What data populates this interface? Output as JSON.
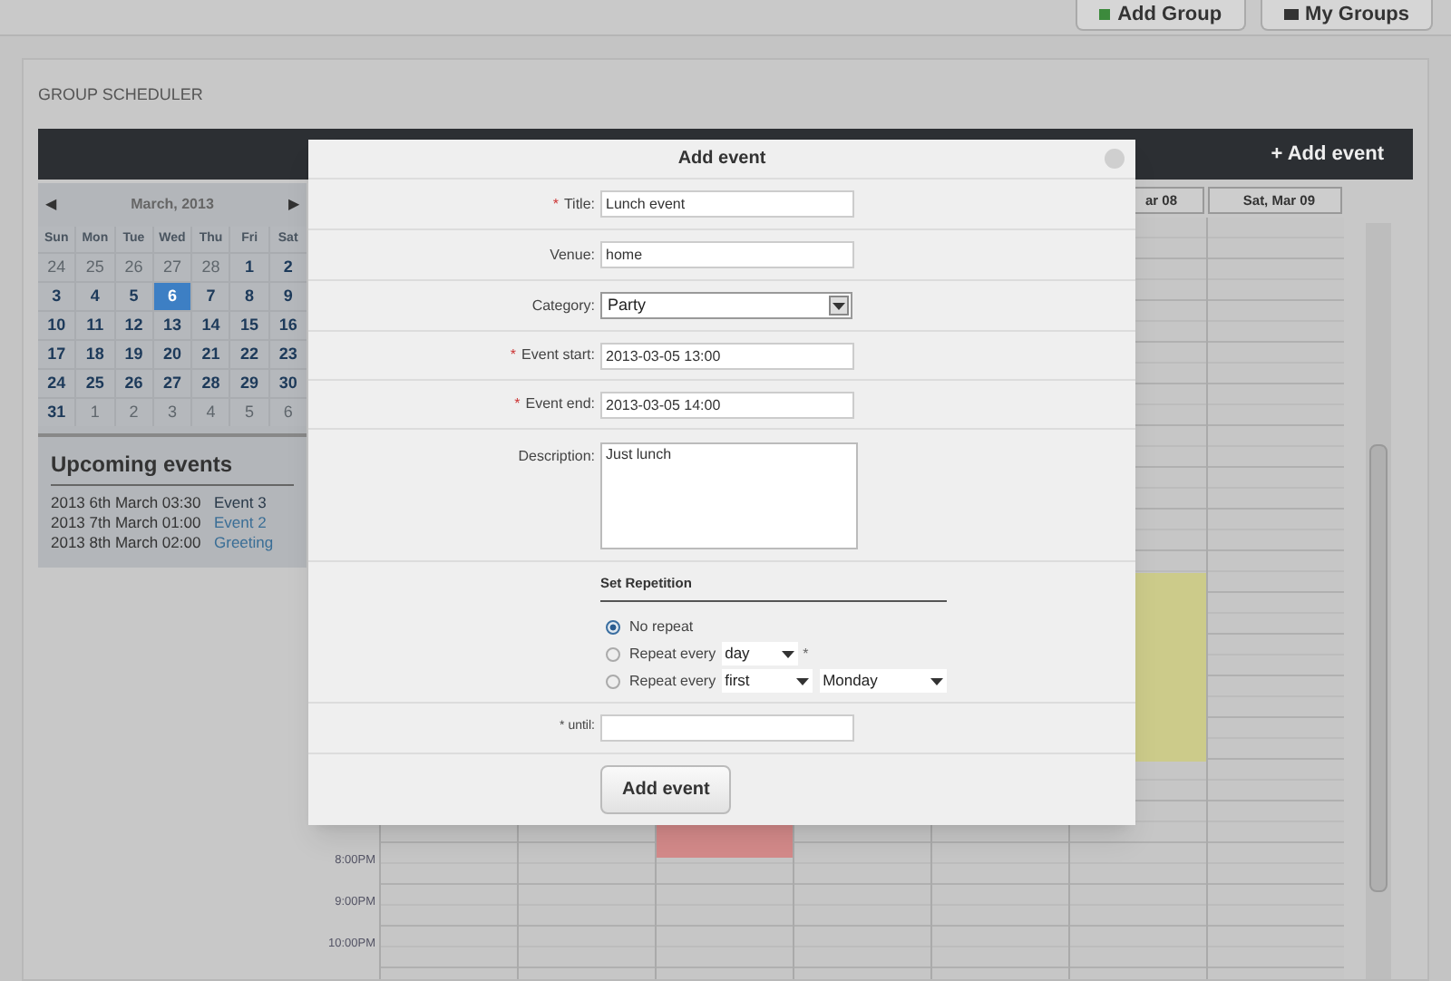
{
  "top_bar": {
    "buttons": [
      {
        "label": "Add Group"
      },
      {
        "label": "My Groups"
      }
    ]
  },
  "panel": {
    "title": "GROUP SCHEDULER"
  },
  "toolbar": {
    "add_button": "+ Add event"
  },
  "mini_calendar": {
    "month": "March, 2013",
    "prev": "◀",
    "next": "▶",
    "weekdays": [
      "Sun",
      "Mon",
      "Tue",
      "Wed",
      "Thu",
      "Fri",
      "Sat"
    ],
    "weeks": [
      [
        {
          "day": "24",
          "other_month": true,
          "selected": false
        },
        {
          "day": "25",
          "other_month": true,
          "selected": false
        },
        {
          "day": "26",
          "other_month": true,
          "selected": false
        },
        {
          "day": "27",
          "other_month": true,
          "selected": false
        },
        {
          "day": "28",
          "other_month": true,
          "selected": false
        },
        {
          "day": "1",
          "other_month": false,
          "selected": false
        },
        {
          "day": "2",
          "other_month": false,
          "selected": false
        }
      ],
      [
        {
          "day": "3",
          "other_month": false,
          "selected": false
        },
        {
          "day": "4",
          "other_month": false,
          "selected": false
        },
        {
          "day": "5",
          "other_month": false,
          "selected": false
        },
        {
          "day": "6",
          "other_month": false,
          "selected": true
        },
        {
          "day": "7",
          "other_month": false,
          "selected": false
        },
        {
          "day": "8",
          "other_month": false,
          "selected": false
        },
        {
          "day": "9",
          "other_month": false,
          "selected": false
        }
      ],
      [
        {
          "day": "10",
          "other_month": false,
          "selected": false
        },
        {
          "day": "11",
          "other_month": false,
          "selected": false
        },
        {
          "day": "12",
          "other_month": false,
          "selected": false
        },
        {
          "day": "13",
          "other_month": false,
          "selected": false
        },
        {
          "day": "14",
          "other_month": false,
          "selected": false
        },
        {
          "day": "15",
          "other_month": false,
          "selected": false
        },
        {
          "day": "16",
          "other_month": false,
          "selected": false
        }
      ],
      [
        {
          "day": "17",
          "other_month": false,
          "selected": false
        },
        {
          "day": "18",
          "other_month": false,
          "selected": false
        },
        {
          "day": "19",
          "other_month": false,
          "selected": false
        },
        {
          "day": "20",
          "other_month": false,
          "selected": false
        },
        {
          "day": "21",
          "other_month": false,
          "selected": false
        },
        {
          "day": "22",
          "other_month": false,
          "selected": false
        },
        {
          "day": "23",
          "other_month": false,
          "selected": false
        }
      ],
      [
        {
          "day": "24",
          "other_month": false,
          "selected": false
        },
        {
          "day": "25",
          "other_month": false,
          "selected": false
        },
        {
          "day": "26",
          "other_month": false,
          "selected": false
        },
        {
          "day": "27",
          "other_month": false,
          "selected": false
        },
        {
          "day": "28",
          "other_month": false,
          "selected": false
        },
        {
          "day": "29",
          "other_month": false,
          "selected": false
        },
        {
          "day": "30",
          "other_month": false,
          "selected": false
        }
      ],
      [
        {
          "day": "31",
          "other_month": false,
          "selected": false
        },
        {
          "day": "1",
          "other_month": true,
          "selected": false
        },
        {
          "day": "2",
          "other_month": true,
          "selected": false
        },
        {
          "day": "3",
          "other_month": true,
          "selected": false
        },
        {
          "day": "4",
          "other_month": true,
          "selected": false
        },
        {
          "day": "5",
          "other_month": true,
          "selected": false
        },
        {
          "day": "6",
          "other_month": true,
          "selected": false
        }
      ]
    ]
  },
  "upcoming": {
    "title": "Upcoming events",
    "items": [
      {
        "date": "2013 6th March 03:30",
        "name": "Event 3",
        "color": "#2a3a4a"
      },
      {
        "date": "2013 7th March 01:00",
        "name": "Event 2",
        "color": "#3a6e96"
      },
      {
        "date": "2013 8th March 02:00",
        "name": "Greeting",
        "color": "#3a6e96"
      }
    ]
  },
  "week_grid": {
    "times": [
      "8:00PM",
      "9:00PM",
      "10:00PM"
    ],
    "columns": [
      {},
      {},
      {
        "events": [
          {
            "color": "#d48a8a"
          }
        ]
      },
      {},
      {},
      {
        "header": "ar 08",
        "events": [
          {
            "color": "#cccb8a"
          }
        ]
      },
      {
        "header": "Sat, Mar 09"
      }
    ]
  },
  "dialog": {
    "title": "Add event",
    "fields": [
      {
        "kind": "text",
        "required_mark": "*",
        "label": "Title:",
        "value": "Lunch event"
      },
      {
        "kind": "text",
        "label": "Venue:",
        "value": "home"
      },
      {
        "kind": "select",
        "label": "Category:",
        "value": "Party"
      },
      {
        "kind": "text",
        "required_mark": "*",
        "label": "Event start:",
        "value": "2013-03-05 13:00"
      },
      {
        "kind": "text",
        "required_mark": "*",
        "label": "Event end:",
        "value": "2013-03-05 14:00"
      },
      {
        "kind": "textarea",
        "label": "Description:",
        "value": "Just lunch"
      }
    ],
    "repetition": {
      "title": "Set Repetition",
      "options": [
        {
          "label": "No repeat",
          "selected": true
        },
        {
          "label": "Repeat every",
          "selected": false,
          "selects": [
            "day"
          ],
          "suffix": "*"
        },
        {
          "label": "Repeat every",
          "selected": false,
          "selects": [
            "first",
            "Monday"
          ]
        }
      ]
    },
    "until": {
      "label": "* until:"
    },
    "submit": "Add event"
  }
}
